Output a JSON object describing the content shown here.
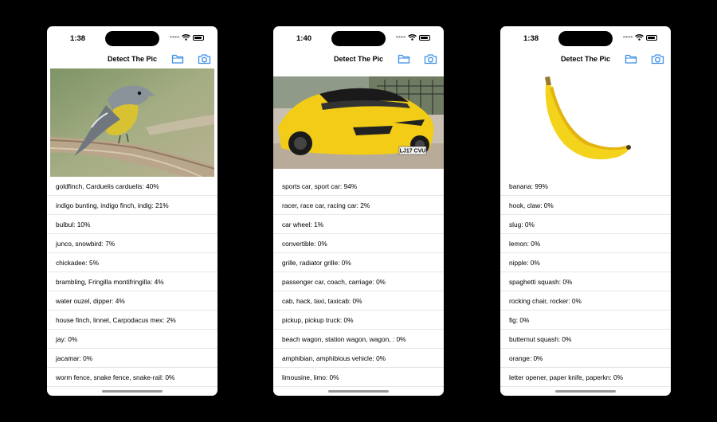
{
  "screens": [
    {
      "time": "1:38",
      "title": "Detect The Pic",
      "image": "bird-photo",
      "results": [
        "goldfinch, Carduelis carduelis: 40%",
        "indigo bunting, indigo finch, indig: 21%",
        "bulbul: 10%",
        "junco, snowbird: 7%",
        "chickadee: 5%",
        "brambling, Fringilla montifringilla: 4%",
        "water ouzel, dipper: 4%",
        "house finch, linnet, Carpodacus mex: 2%",
        "jay: 0%",
        "jacamar: 0%",
        "worm fence, snake fence, snake-rail: 0%"
      ]
    },
    {
      "time": "1:40",
      "title": "Detect The Pic",
      "image": "sports-car-photo",
      "plate": "LJ17 CVU",
      "results": [
        "sports car, sport car: 94%",
        "racer, race car, racing car: 2%",
        "car wheel: 1%",
        "convertible: 0%",
        "grille, radiator grille: 0%",
        "passenger car, coach, carriage: 0%",
        "cab, hack, taxi, taxicab: 0%",
        "pickup, pickup truck: 0%",
        "beach wagon, station wagon, wagon, : 0%",
        "amphibian, amphibious vehicle: 0%",
        "limousine, limo: 0%"
      ]
    },
    {
      "time": "1:38",
      "title": "Detect The Pic",
      "image": "banana-photo",
      "results": [
        "banana: 99%",
        "hook, claw: 0%",
        "slug: 0%",
        "lemon: 0%",
        "nipple: 0%",
        "spaghetti squash: 0%",
        "rocking chair, rocker: 0%",
        "fig: 0%",
        "butternut squash: 0%",
        "orange: 0%",
        "letter opener, paper knife, paperkn: 0%"
      ]
    }
  ],
  "colors": {
    "accent": "#3a8ee6",
    "background": "#000000",
    "divider": "#e6e6e6"
  },
  "icons": {
    "folder": "folder-icon",
    "camera": "camera-icon"
  }
}
